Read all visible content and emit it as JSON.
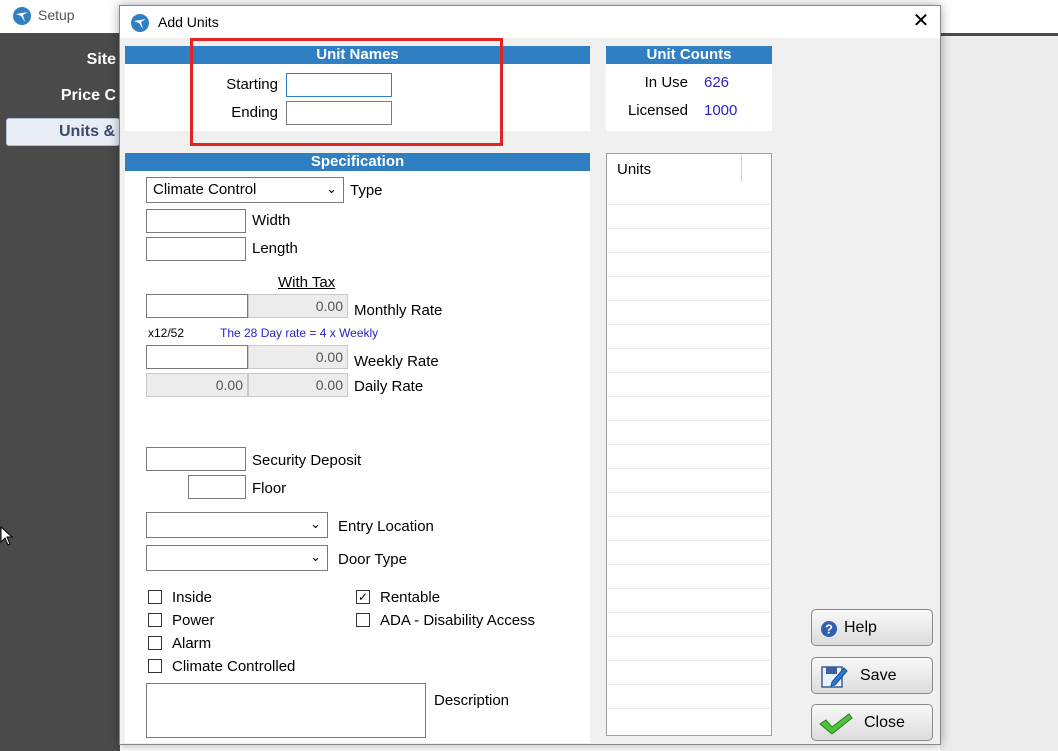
{
  "background": {
    "app_title": "Setup",
    "sidebar": [
      {
        "label": "Site"
      },
      {
        "label": "Price C"
      },
      {
        "label": "Units &"
      }
    ]
  },
  "dialog": {
    "title": "Add Units",
    "close_glyph": "✕",
    "unit_names": {
      "header": "Unit Names",
      "starting_label": "Starting",
      "starting_value": "",
      "ending_label": "Ending",
      "ending_value": ""
    },
    "unit_counts": {
      "header": "Unit Counts",
      "in_use_label": "In Use",
      "in_use_value": "626",
      "licensed_label": "Licensed",
      "licensed_value": "1000"
    },
    "specification": {
      "header": "Specification",
      "type_value": "Climate Control",
      "type_label": "Type",
      "width_label": "Width",
      "length_label": "Length",
      "with_tax_label": "With Tax",
      "monthly_value": "0.00",
      "monthly_label": "Monthly Rate",
      "ratio_label": "x12/52",
      "note": "The 28 Day rate = 4 x Weekly",
      "weekly_value": "0.00",
      "weekly_label": "Weekly Rate",
      "daily_value_left": "0.00",
      "daily_value": "0.00",
      "daily_label": "Daily Rate",
      "deposit_label": "Security Deposit",
      "floor_label": "Floor",
      "entry_label": "Entry Location",
      "door_label": "Door Type",
      "inside_label": "Inside",
      "power_label": "Power",
      "alarm_label": "Alarm",
      "climate_label": "Climate Controlled",
      "rentable_label": "Rentable",
      "ada_label": "ADA - Disability Access",
      "description_label": "Description",
      "rentable_checked": true
    },
    "units_list": {
      "header": "Units"
    },
    "buttons": {
      "help": "Help",
      "save": "Save",
      "close": "Close"
    }
  },
  "colors": {
    "section_header": "#2f7fc2",
    "link_value": "#2a22c8",
    "highlight": "#e02424"
  }
}
